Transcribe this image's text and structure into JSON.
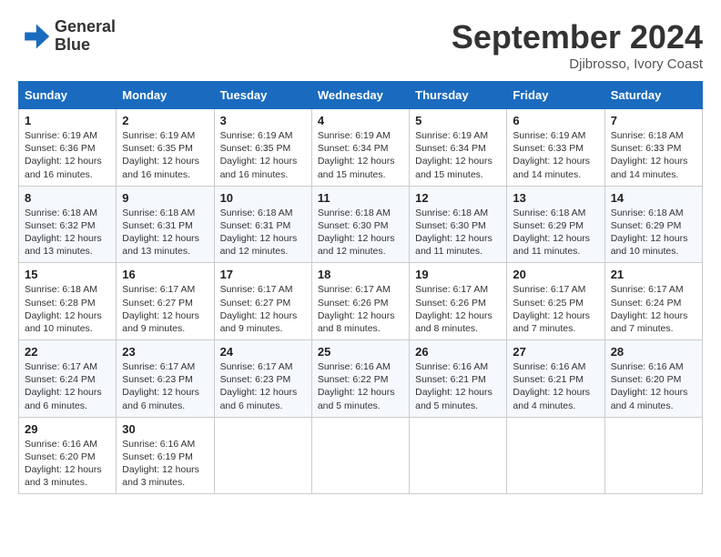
{
  "header": {
    "logo_line1": "General",
    "logo_line2": "Blue",
    "month_title": "September 2024",
    "location": "Djibrosso, Ivory Coast"
  },
  "days_of_week": [
    "Sunday",
    "Monday",
    "Tuesday",
    "Wednesday",
    "Thursday",
    "Friday",
    "Saturday"
  ],
  "weeks": [
    [
      {
        "day": "1",
        "sunrise": "6:19 AM",
        "sunset": "6:36 PM",
        "daylight": "12 hours and 16 minutes."
      },
      {
        "day": "2",
        "sunrise": "6:19 AM",
        "sunset": "6:35 PM",
        "daylight": "12 hours and 16 minutes."
      },
      {
        "day": "3",
        "sunrise": "6:19 AM",
        "sunset": "6:35 PM",
        "daylight": "12 hours and 16 minutes."
      },
      {
        "day": "4",
        "sunrise": "6:19 AM",
        "sunset": "6:34 PM",
        "daylight": "12 hours and 15 minutes."
      },
      {
        "day": "5",
        "sunrise": "6:19 AM",
        "sunset": "6:34 PM",
        "daylight": "12 hours and 15 minutes."
      },
      {
        "day": "6",
        "sunrise": "6:19 AM",
        "sunset": "6:33 PM",
        "daylight": "12 hours and 14 minutes."
      },
      {
        "day": "7",
        "sunrise": "6:18 AM",
        "sunset": "6:33 PM",
        "daylight": "12 hours and 14 minutes."
      }
    ],
    [
      {
        "day": "8",
        "sunrise": "6:18 AM",
        "sunset": "6:32 PM",
        "daylight": "12 hours and 13 minutes."
      },
      {
        "day": "9",
        "sunrise": "6:18 AM",
        "sunset": "6:31 PM",
        "daylight": "12 hours and 13 minutes."
      },
      {
        "day": "10",
        "sunrise": "6:18 AM",
        "sunset": "6:31 PM",
        "daylight": "12 hours and 12 minutes."
      },
      {
        "day": "11",
        "sunrise": "6:18 AM",
        "sunset": "6:30 PM",
        "daylight": "12 hours and 12 minutes."
      },
      {
        "day": "12",
        "sunrise": "6:18 AM",
        "sunset": "6:30 PM",
        "daylight": "12 hours and 11 minutes."
      },
      {
        "day": "13",
        "sunrise": "6:18 AM",
        "sunset": "6:29 PM",
        "daylight": "12 hours and 11 minutes."
      },
      {
        "day": "14",
        "sunrise": "6:18 AM",
        "sunset": "6:29 PM",
        "daylight": "12 hours and 10 minutes."
      }
    ],
    [
      {
        "day": "15",
        "sunrise": "6:18 AM",
        "sunset": "6:28 PM",
        "daylight": "12 hours and 10 minutes."
      },
      {
        "day": "16",
        "sunrise": "6:17 AM",
        "sunset": "6:27 PM",
        "daylight": "12 hours and 9 minutes."
      },
      {
        "day": "17",
        "sunrise": "6:17 AM",
        "sunset": "6:27 PM",
        "daylight": "12 hours and 9 minutes."
      },
      {
        "day": "18",
        "sunrise": "6:17 AM",
        "sunset": "6:26 PM",
        "daylight": "12 hours and 8 minutes."
      },
      {
        "day": "19",
        "sunrise": "6:17 AM",
        "sunset": "6:26 PM",
        "daylight": "12 hours and 8 minutes."
      },
      {
        "day": "20",
        "sunrise": "6:17 AM",
        "sunset": "6:25 PM",
        "daylight": "12 hours and 7 minutes."
      },
      {
        "day": "21",
        "sunrise": "6:17 AM",
        "sunset": "6:24 PM",
        "daylight": "12 hours and 7 minutes."
      }
    ],
    [
      {
        "day": "22",
        "sunrise": "6:17 AM",
        "sunset": "6:24 PM",
        "daylight": "12 hours and 6 minutes."
      },
      {
        "day": "23",
        "sunrise": "6:17 AM",
        "sunset": "6:23 PM",
        "daylight": "12 hours and 6 minutes."
      },
      {
        "day": "24",
        "sunrise": "6:17 AM",
        "sunset": "6:23 PM",
        "daylight": "12 hours and 6 minutes."
      },
      {
        "day": "25",
        "sunrise": "6:16 AM",
        "sunset": "6:22 PM",
        "daylight": "12 hours and 5 minutes."
      },
      {
        "day": "26",
        "sunrise": "6:16 AM",
        "sunset": "6:21 PM",
        "daylight": "12 hours and 5 minutes."
      },
      {
        "day": "27",
        "sunrise": "6:16 AM",
        "sunset": "6:21 PM",
        "daylight": "12 hours and 4 minutes."
      },
      {
        "day": "28",
        "sunrise": "6:16 AM",
        "sunset": "6:20 PM",
        "daylight": "12 hours and 4 minutes."
      }
    ],
    [
      {
        "day": "29",
        "sunrise": "6:16 AM",
        "sunset": "6:20 PM",
        "daylight": "12 hours and 3 minutes."
      },
      {
        "day": "30",
        "sunrise": "6:16 AM",
        "sunset": "6:19 PM",
        "daylight": "12 hours and 3 minutes."
      },
      null,
      null,
      null,
      null,
      null
    ]
  ]
}
